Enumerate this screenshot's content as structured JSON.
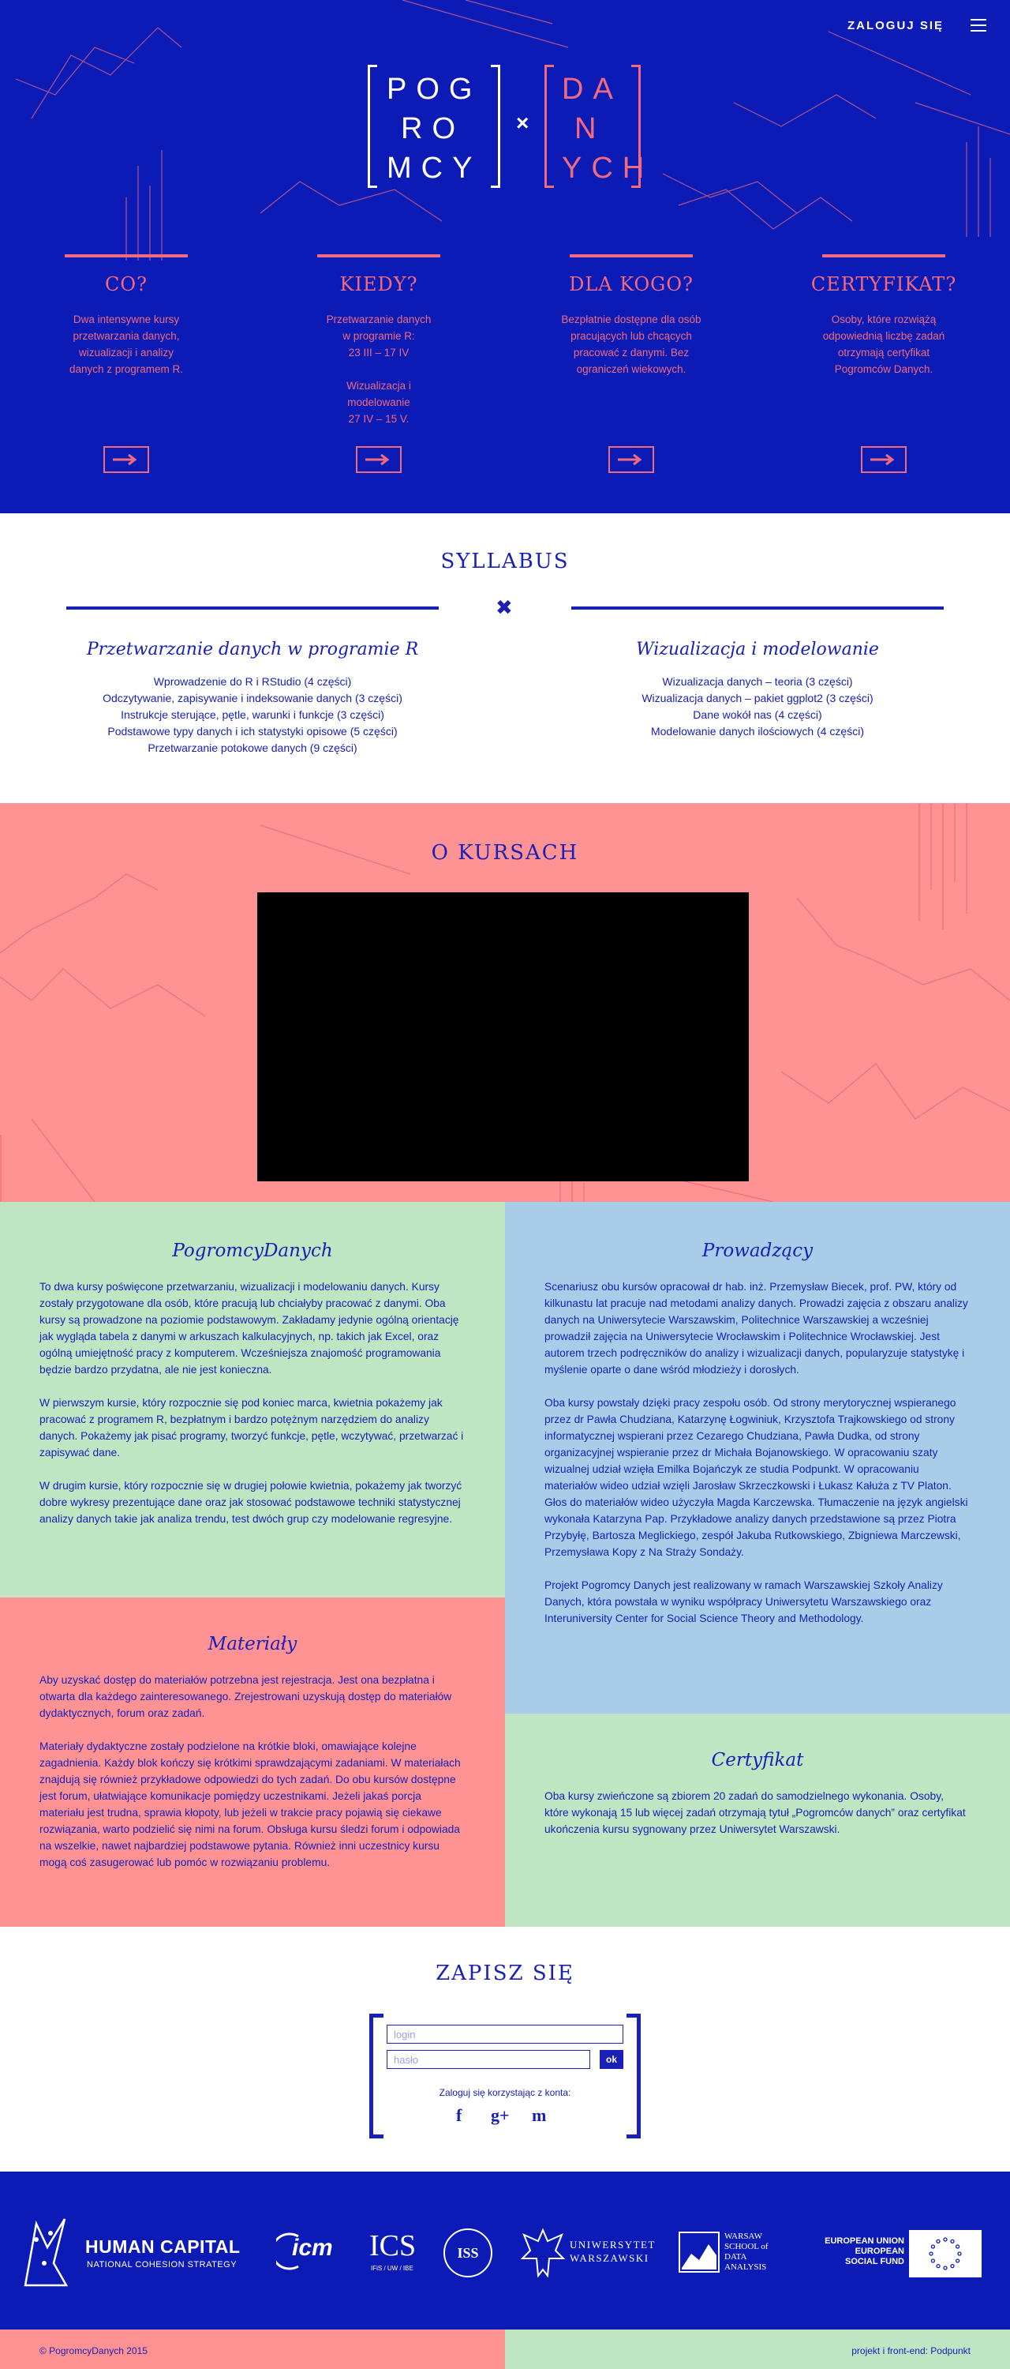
{
  "header": {
    "login_label": "ZALOGUJ SIĘ"
  },
  "logo": {
    "left_lines": [
      "POG",
      "RO",
      "MCY"
    ],
    "times": "×",
    "right_lines": [
      "DA",
      "N",
      "YCH"
    ]
  },
  "features": [
    {
      "title": "CO?",
      "text": "Dwa intensywne kursy\nprzetwarzania danych,\nwizualizacji i analizy\ndanych z programem R."
    },
    {
      "title": "KIEDY?",
      "text": "Przetwarzanie danych\nw programie R:\n23 III – 17 IV\n\nWizualizacja i modelowanie\n27 IV – 15 V."
    },
    {
      "title": "DLA KOGO?",
      "text": "Bezpłatnie dostępne dla osób\npracujących lub chcących\npracować z danymi. Bez\nograniczeń wiekowych."
    },
    {
      "title": "CERTYFIKAT?",
      "text": "Osoby, które rozwiążą\nodpowiednią liczbę zadań\notrzymają certyfikat\nPogromców Danych."
    }
  ],
  "syllabus": {
    "title": "SYLLABUS",
    "separator": "✖",
    "left": {
      "heading": "Przetwarzanie danych w programie R",
      "items": [
        "Wprowadzenie do R i RStudio (4 części)",
        "Odczytywanie, zapisywanie i indeksowanie danych (3 części)",
        "Instrukcje sterujące, pętle, warunki i funkcje (3 części)",
        "Podstawowe typy danych i ich statystyki opisowe (5 części)",
        "Przetwarzanie potokowe danych (9 części)"
      ]
    },
    "right": {
      "heading": "Wizualizacja i modelowanie",
      "items": [
        "Wizualizacja danych – teoria (3 części)",
        "Wizualizacja danych – pakiet ggplot2 (3 części)",
        "Dane wokół nas (4 części)",
        "Modelowanie danych ilościowych (4 części)"
      ]
    }
  },
  "about": {
    "title": "O KURSACH"
  },
  "panels": {
    "pogromcy": {
      "heading": "PogromcyDanych",
      "paragraphs": [
        "To dwa kursy poświęcone przetwarzaniu, wizualizacji i modelowaniu danych. Kursy zostały przygotowane dla osób, które pracują lub chciałyby pracować z danymi. Oba kursy są prowadzone na poziomie podstawowym. Zakładamy jedynie ogólną orientację jak wygląda tabela z danymi w arkuszach kalkulacyjnych, np. takich jak Excel, oraz ogólną umiejętność pracy z komputerem. Wcześniejsza znajomość programowania będzie bardzo przydatna, ale nie jest konieczna.",
        "W pierwszym kursie, który rozpocznie się pod koniec marca, kwietnia pokażemy jak pracować z programem R, bezpłatnym i bardzo potężnym narzędziem do analizy danych. Pokażemy jak pisać programy, tworzyć funkcje, pętle, wczytywać, przetwarzać i zapisywać dane.",
        "W drugim kursie, który rozpocznie się w drugiej połowie kwietnia, pokażemy jak tworzyć dobre wykresy prezentujące dane oraz jak stosować podstawowe techniki statystycznej analizy danych takie jak analiza trendu, test dwóch grup czy modelowanie regresyjne."
      ]
    },
    "prowadzacy": {
      "heading": "Prowadzący",
      "paragraphs": [
        "Scenariusz obu kursów opracował dr hab. inż. Przemysław Biecek, prof. PW, który od kilkunastu lat pracuje nad metodami analizy danych. Prowadzi zajęcia z obszaru analizy danych na Uniwersytecie Warszawskim, Politechnice Warszawskiej a wcześniej prowadził zajęcia na Uniwersytecie Wrocławskim i Politechnice Wrocławskiej. Jest autorem trzech podręczników do analizy i wizualizacji danych, popularyzuje statystykę i myślenie oparte o dane wśród młodzieży i dorosłych.",
        "Oba kursy powstały dzięki pracy zespołu osób. Od strony merytorycznej wspieranego przez dr Pawła Chudziana, Katarzynę Łogwiniuk, Krzysztofa Trajkowskiego od strony informatycznej wspierani przez Cezarego Chudziana, Pawła Dudka, od strony organizacyjnej wspieranie przez dr Michała Bojanowskiego. W opracowaniu szaty wizualnej udział wzięła Emilka Bojańczyk ze studia Podpunkt. W opracowaniu materiałów wideo udział wzięli Jarosław Skrzeczkowski i Łukasz Kałuża z TV Platon. Głos do materiałów wideo użyczyła Magda Karczewska. Tłumaczenie na język angielski wykonała Katarzyna Pap. Przykładowe analizy danych przedstawione są przez Piotra Przybyłę, Bartosza Meglickiego, zespół Jakuba Rutkowskiego, Zbigniewa Marczewski, Przemysława Kopy z Na Straży Sondaży.",
        "Projekt Pogromcy Danych jest realizowany w ramach Warszawskiej Szkoły Analizy Danych, która powstała w wyniku współpracy Uniwersytetu Warszawskiego oraz Interuniversity Center for Social Science Theory and Methodology."
      ]
    },
    "materialy": {
      "heading": "Materiały",
      "paragraphs": [
        "Aby uzyskać dostęp do materiałów potrzebna jest rejestracja. Jest ona bezpłatna i otwarta dla każdego zainteresowanego. Zrejestrowani uzyskują dostęp do materiałów dydaktycznych, forum oraz zadań.",
        "Materiały dydaktyczne zostały podzielone na krótkie bloki, omawiające kolejne zagadnienia. Każdy blok kończy się krótkimi sprawdzającymi zadaniami. W materiałach znajdują się również przykładowe odpowiedzi do tych zadań. Do obu kursów dostępne jest forum, ułatwiające komunikacje pomiędzy uczestnikami. Jeżeli jakaś porcja materiału jest trudna, sprawia kłopoty, lub jeżeli w trakcie pracy pojawią się ciekawe rozwiązania, warto podzielić się nimi na forum. Obsługa kursu śledzi forum i odpowiada na wszelkie, nawet najbardziej podstawowe pytania. Również inni uczestnicy kursu mogą coś zasugerować lub pomóc w rozwiązaniu problemu."
      ]
    },
    "certyfikat": {
      "heading": "Certyfikat",
      "paragraphs": [
        "Oba kursy zwieńczone są zbiorem 20 zadań do samodzielnego wykonania. Osoby, które wykonają 15 lub więcej zadań otrzymają tytuł „Pogromców danych” oraz certyfikat ukończenia kursu sygnowany przez Uniwersytet Warszawski."
      ]
    }
  },
  "signup": {
    "title": "ZAPISZ SIĘ",
    "login_placeholder": "login",
    "password_placeholder": "hasło",
    "ok_label": "ok",
    "social_label": "Zaloguj się korzystając z konta:",
    "facebook": "f",
    "googleplus": "g+",
    "other": "m"
  },
  "partners": {
    "human_capital": "HUMAN CAPITAL",
    "human_capital_sub": "NATIONAL COHESION STRATEGY",
    "icm": "icm",
    "ics": "ICS",
    "ics_sub": "IFiS / UW / IBE",
    "iss": "ISS",
    "uw": [
      "UNIWERSYTET",
      "WARSZAWSKI"
    ],
    "wsda": [
      "WARSAW",
      "SCHOOL of",
      "DATA",
      "ANALYSIS"
    ],
    "eu": [
      "EUROPEAN UNION",
      "EUROPEAN",
      "SOCIAL FUND"
    ]
  },
  "footer": {
    "copyright": "© PogromcyDanych 2015",
    "credits": "projekt i front-end: Podpunkt"
  },
  "colors": {
    "blue": "#0c1bb5",
    "pink": "#f26a7e",
    "salmon": "#ff9394",
    "mint": "#bfe5c3",
    "sky": "#a9cde9"
  }
}
